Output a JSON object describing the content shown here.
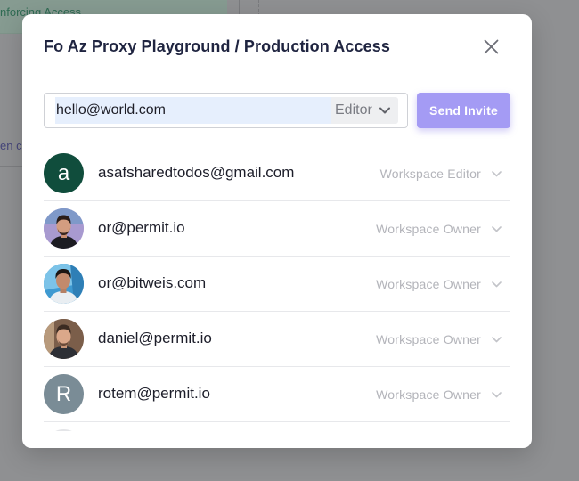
{
  "background": {
    "banner_text": "nforcing Access",
    "left_text": "en c"
  },
  "modal": {
    "title": "Fo Az Proxy Playground / Production Access",
    "invite": {
      "email_value": "hello@world.com",
      "role_value": "Editor",
      "send_label": "Send Invite"
    },
    "members": [
      {
        "email": "asafsharedtodos@gmail.com",
        "role": "Workspace Editor",
        "avatar": {
          "type": "letter",
          "letter": "a",
          "color": "#104d3c"
        }
      },
      {
        "email": "or@permit.io",
        "role": "Workspace Owner",
        "avatar": {
          "type": "photo"
        }
      },
      {
        "email": "or@bitweis.com",
        "role": "Workspace Owner",
        "avatar": {
          "type": "photo"
        }
      },
      {
        "email": "daniel@permit.io",
        "role": "Workspace Owner",
        "avatar": {
          "type": "photo"
        }
      },
      {
        "email": "rotem@permit.io",
        "role": "Workspace Owner",
        "avatar": {
          "type": "letter",
          "letter": "R",
          "color": "#7a8c96"
        }
      }
    ]
  },
  "colors": {
    "accent": "#a49bf4",
    "title": "#1f2440",
    "muted": "#b3b4ba",
    "overlay": "#8f9092"
  }
}
